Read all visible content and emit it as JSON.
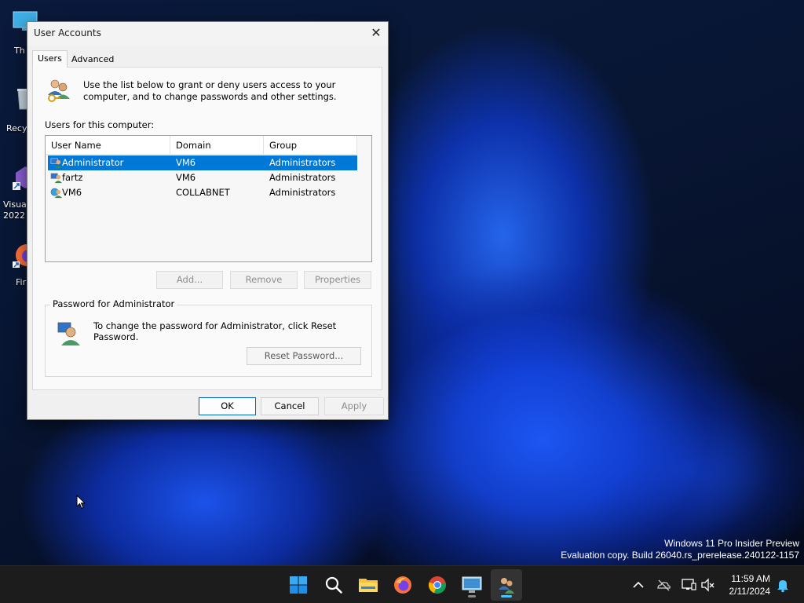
{
  "desktop": {
    "icons": [
      {
        "label": "Th"
      },
      {
        "label": "Recy"
      },
      {
        "label": "Visua 2022"
      },
      {
        "label": "Fir"
      }
    ],
    "watermark": {
      "line1": "Windows 11 Pro Insider Preview",
      "line2": "Evaluation copy. Build 26040.rs_prerelease.240122-1157"
    }
  },
  "dialog": {
    "title": "User Accounts",
    "close_glyph": "✕",
    "tabs": [
      {
        "label": "Users",
        "active": true
      },
      {
        "label": "Advanced",
        "active": false
      }
    ],
    "intro": "Use the list below to grant or deny users access to your computer, and to change passwords and other settings.",
    "users_label": "Users for this computer:",
    "columns": [
      "User Name",
      "Domain",
      "Group"
    ],
    "rows": [
      {
        "name": "Administrator",
        "domain": "VM6",
        "group": "Administrators"
      },
      {
        "name": "fartz",
        "domain": "VM6",
        "group": "Administrators"
      },
      {
        "name": "VM6",
        "domain": "COLLABNET",
        "group": "Administrators"
      }
    ],
    "selected_row": 0,
    "list_buttons": {
      "add": "Add...",
      "remove": "Remove",
      "properties": "Properties"
    },
    "password_group": {
      "legend": "Password for Administrator",
      "text": "To change the password for Administrator, click Reset Password.",
      "reset_button": "Reset Password..."
    },
    "footer_buttons": {
      "ok": "OK",
      "cancel": "Cancel",
      "apply": "Apply"
    }
  },
  "taskbar": {
    "apps": [
      "start-icon",
      "search-icon",
      "file-explorer-icon",
      "firefox-icon",
      "chrome-icon",
      "remote-desktop-icon",
      "user-accounts-icon"
    ],
    "clock": {
      "time": "11:59 AM",
      "date": "2/11/2024"
    }
  },
  "colors": {
    "selection": "#0078d7",
    "accent": "#0067c0",
    "taskbar": "#1c1c1c"
  }
}
